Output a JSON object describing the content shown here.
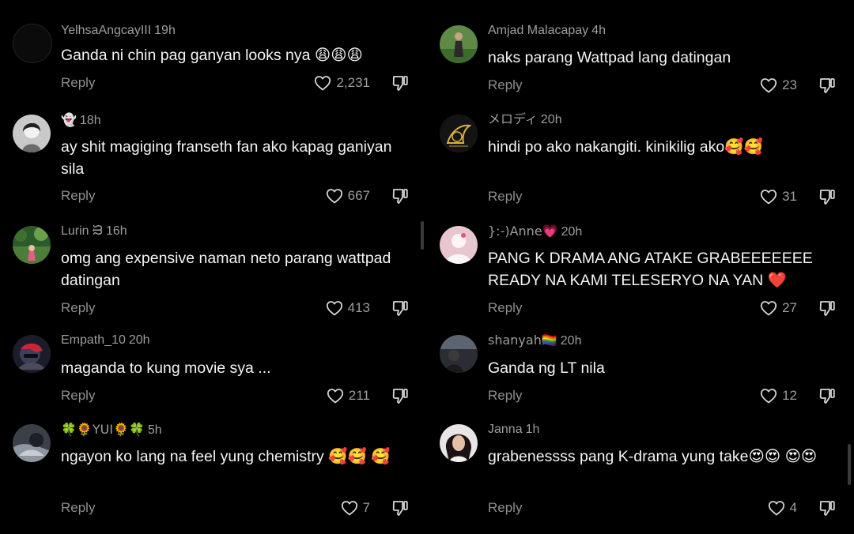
{
  "common": {
    "reply_label": "Reply"
  },
  "left_comments": [
    {
      "username": "YelhsaAngcayIII",
      "time": "19h",
      "text": "Ganda ni chin pag ganyan looks nya 😩😩😩",
      "likes": "2,231"
    },
    {
      "username": "👻",
      "time": "18h",
      "text": "ay shit magiging franseth fan ako kapag ganiyan sila",
      "likes": "667"
    },
    {
      "username": "Lurin ᙣ",
      "time": "16h",
      "text": "omg ang expensive naman neto parang wattpad datingan",
      "likes": "413"
    },
    {
      "username": "Empath_10",
      "time": "20h",
      "text": "maganda to kung movie sya ...",
      "likes": "211"
    },
    {
      "username": "🍀🌻YUI🌻🍀",
      "time": "5h",
      "text": "ngayon ko lang na feel yung chemistry 🥰🥰 🥰",
      "likes": "7"
    }
  ],
  "right_comments": [
    {
      "username": "Amjad Malacapay",
      "time": "4h",
      "text": "naks parang Wattpad lang datingan",
      "likes": "23"
    },
    {
      "username": "メロディ",
      "time": "20h",
      "text": "hindi po ako nakangiti. kinikilig ako🥰🥰",
      "likes": "31"
    },
    {
      "username": "}:-)Anne💗",
      "time": "20h",
      "text": "PANG K DRAMA ANG ATAKE GRABEEEEEEE READY NA KAMI TELESERYO NA YAN ❤️",
      "likes": "27"
    },
    {
      "username": "shanyah🏳️‍🌈",
      "time": "20h",
      "text": "Ganda ng LT nila",
      "likes": "12"
    },
    {
      "username": "Janna",
      "time": "1h",
      "text": "grabenessss pang K-drama yung take😍😍 😍😍",
      "likes": "4"
    }
  ]
}
